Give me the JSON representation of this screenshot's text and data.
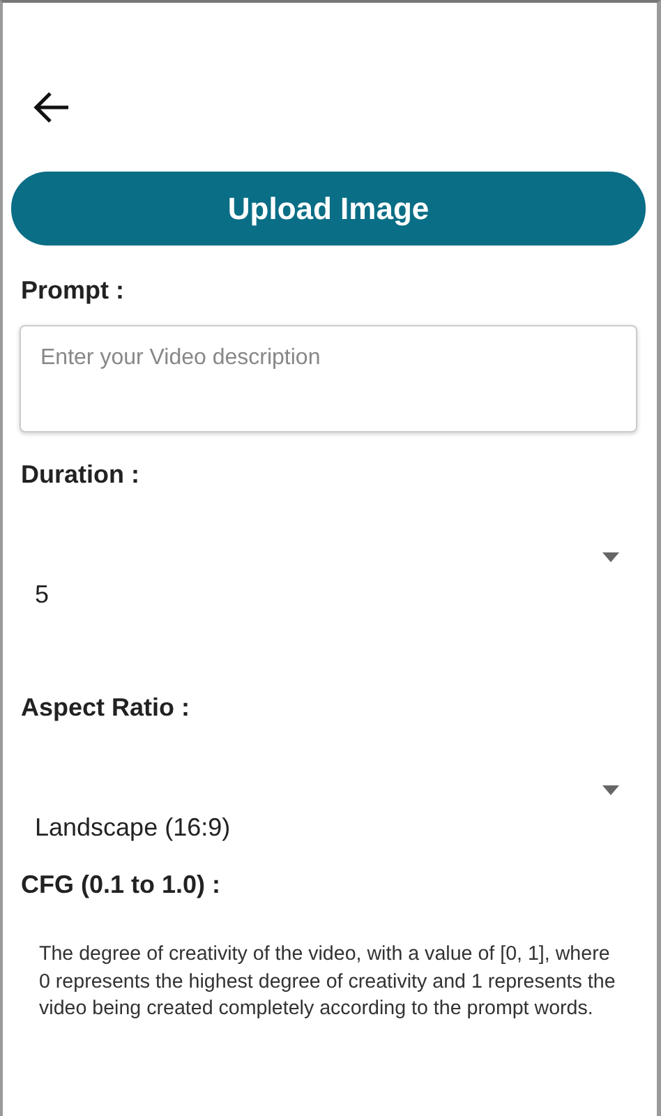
{
  "upload_button": {
    "label": "Upload Image"
  },
  "prompt": {
    "label": "Prompt :",
    "placeholder": "Enter your Video description"
  },
  "duration": {
    "label": "Duration :",
    "value": "5"
  },
  "aspect_ratio": {
    "label": "Aspect Ratio :",
    "value": "Landscape (16:9)"
  },
  "cfg": {
    "label": "CFG (0.1 to 1.0) :",
    "description": "The degree of creativity of the video, with a value of [0, 1], where 0 represents the highest degree of creativity and 1 represents the video being created completely according to the prompt words."
  }
}
